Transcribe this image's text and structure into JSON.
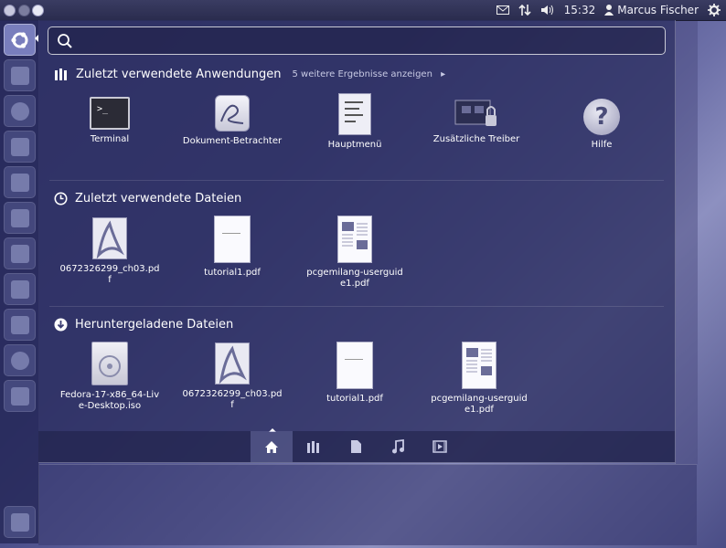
{
  "top_panel": {
    "time": "15:32",
    "user": "Marcus Fischer",
    "icons": [
      "mail-icon",
      "network-icon",
      "volume-icon",
      "user-icon",
      "gear-icon"
    ]
  },
  "dash": {
    "search": {
      "value": "",
      "placeholder": ""
    },
    "applications": {
      "title": "Zuletzt verwendete Anwendungen",
      "more": "5 weitere Ergebnisse anzeigen",
      "items": [
        {
          "label": "Terminal",
          "icon": "terminal-icon"
        },
        {
          "label": "Dokument-Betrachter",
          "icon": "document-viewer-icon"
        },
        {
          "label": "Hauptmenü",
          "icon": "main-menu-icon"
        },
        {
          "label": "Zusätzliche Treiber",
          "icon": "additional-drivers-icon"
        },
        {
          "label": "Hilfe",
          "icon": "help-icon"
        }
      ]
    },
    "files": {
      "title": "Zuletzt verwendete  Dateien",
      "items": [
        {
          "label": "0672326299_ch03.pdf",
          "icon": "pdf-icon"
        },
        {
          "label": "tutorial1.pdf",
          "icon": "document-icon"
        },
        {
          "label": "pcgemilang-userguide1.pdf",
          "icon": "document-icon"
        }
      ]
    },
    "downloads": {
      "title": "Heruntergeladene Dateien",
      "items": [
        {
          "label": "Fedora-17-x86_64-Live-Desktop.iso",
          "icon": "disc-image-icon"
        },
        {
          "label": "0672326299_ch03.pdf",
          "icon": "pdf-icon"
        },
        {
          "label": "tutorial1.pdf",
          "icon": "document-icon"
        },
        {
          "label": "pcgemilang-userguide1.pdf",
          "icon": "document-icon"
        }
      ]
    },
    "lenses": [
      "home-lens",
      "applications-lens",
      "files-lens",
      "music-lens",
      "video-lens"
    ]
  }
}
